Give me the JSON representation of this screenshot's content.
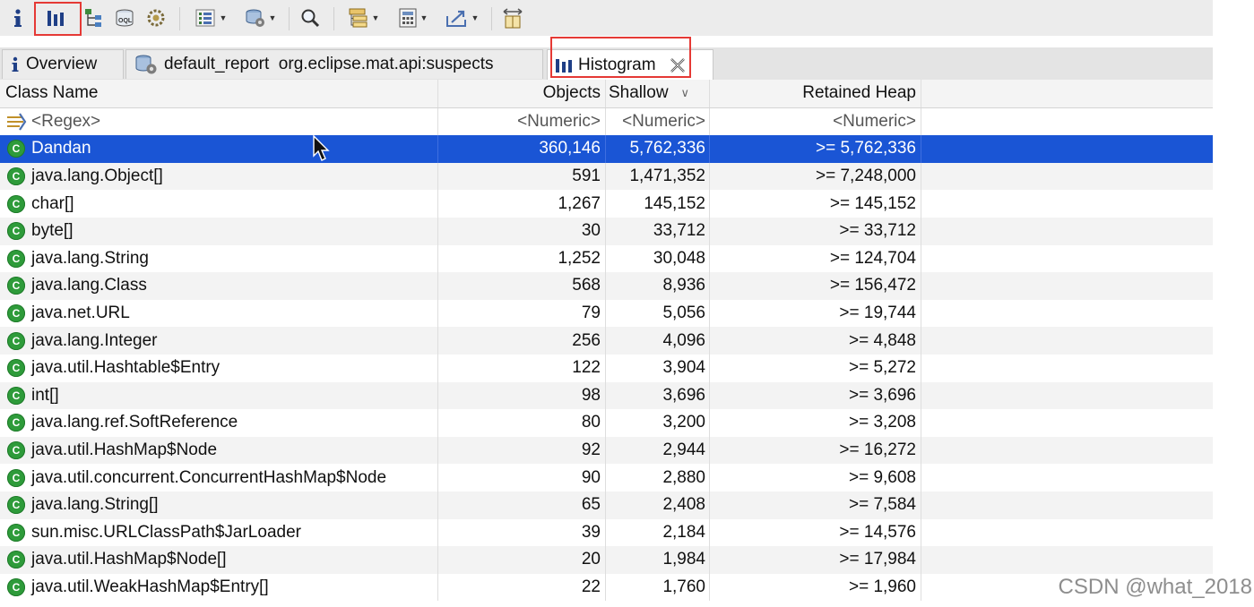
{
  "toolbar": {
    "icons": [
      "info-icon",
      "histogram-icon",
      "dominator-tree-icon",
      "oql-icon",
      "heap-dump-overview-icon",
      "run-expert-system-icon",
      "query-browser-icon",
      "search-icon",
      "group-by-icon",
      "calculate-retained-icon",
      "export-icon",
      "compare-icon"
    ]
  },
  "tabs": [
    {
      "label": "Overview",
      "icon": "info-icon"
    },
    {
      "label": "default_report  org.eclipse.mat.api:suspects",
      "icon": "report-icon"
    },
    {
      "label": "Histogram",
      "icon": "histogram-icon"
    }
  ],
  "table": {
    "headers": {
      "class_name": "Class Name",
      "objects": "Objects",
      "shallow": "Shallow",
      "retained": "Retained Heap"
    },
    "filter": {
      "class_name": "<Regex>",
      "objects": "<Numeric>",
      "shallow": "<Numeric>",
      "retained": "<Numeric>"
    },
    "rows": [
      {
        "name": "Dandan",
        "objects": "360,146",
        "shallow": "5,762,336",
        "retained": ">= 5,762,336"
      },
      {
        "name": "java.lang.Object[]",
        "objects": "591",
        "shallow": "1,471,352",
        "retained": ">= 7,248,000"
      },
      {
        "name": "char[]",
        "objects": "1,267",
        "shallow": "145,152",
        "retained": ">= 145,152"
      },
      {
        "name": "byte[]",
        "objects": "30",
        "shallow": "33,712",
        "retained": ">= 33,712"
      },
      {
        "name": "java.lang.String",
        "objects": "1,252",
        "shallow": "30,048",
        "retained": ">= 124,704"
      },
      {
        "name": "java.lang.Class",
        "objects": "568",
        "shallow": "8,936",
        "retained": ">= 156,472"
      },
      {
        "name": "java.net.URL",
        "objects": "79",
        "shallow": "5,056",
        "retained": ">= 19,744"
      },
      {
        "name": "java.lang.Integer",
        "objects": "256",
        "shallow": "4,096",
        "retained": ">= 4,848"
      },
      {
        "name": "java.util.Hashtable$Entry",
        "objects": "122",
        "shallow": "3,904",
        "retained": ">= 5,272"
      },
      {
        "name": "int[]",
        "objects": "98",
        "shallow": "3,696",
        "retained": ">= 3,696"
      },
      {
        "name": "java.lang.ref.SoftReference",
        "objects": "80",
        "shallow": "3,200",
        "retained": ">= 3,208"
      },
      {
        "name": "java.util.HashMap$Node",
        "objects": "92",
        "shallow": "2,944",
        "retained": ">= 16,272"
      },
      {
        "name": "java.util.concurrent.ConcurrentHashMap$Node",
        "objects": "90",
        "shallow": "2,880",
        "retained": ">= 9,608"
      },
      {
        "name": "java.lang.String[]",
        "objects": "65",
        "shallow": "2,408",
        "retained": ">= 7,584"
      },
      {
        "name": "sun.misc.URLClassPath$JarLoader",
        "objects": "39",
        "shallow": "2,184",
        "retained": ">= 14,576"
      },
      {
        "name": "java.util.HashMap$Node[]",
        "objects": "20",
        "shallow": "1,984",
        "retained": ">= 17,984"
      },
      {
        "name": "java.util.WeakHashMap$Entry[]",
        "objects": "22",
        "shallow": "1,760",
        "retained": ">= 1,960"
      }
    ]
  },
  "watermark": "CSDN @what_2018",
  "colors": {
    "selection": "#1a55d5",
    "class_icon": "#2e9b3a",
    "highlight": "#e53935"
  }
}
